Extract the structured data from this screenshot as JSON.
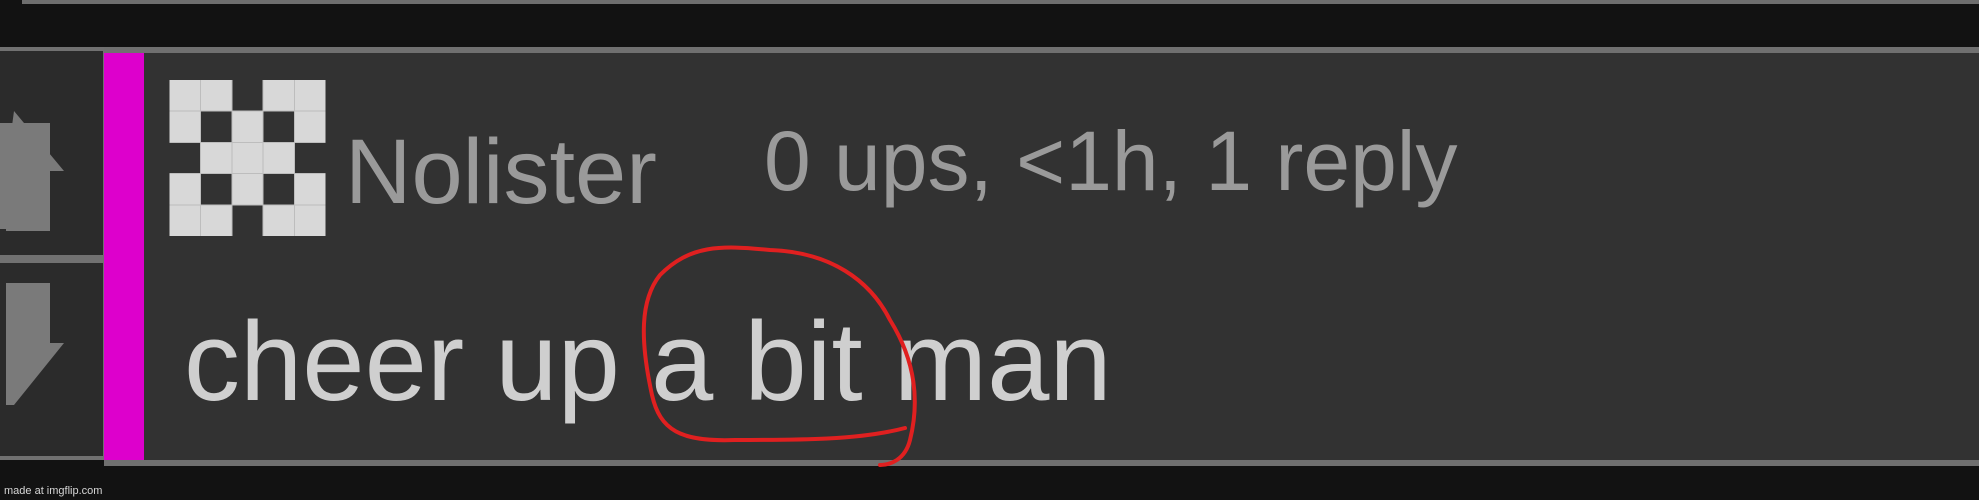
{
  "comment": {
    "username": "Nolister",
    "meta": "0 ups, <1h, 1 reply",
    "body": "cheer up a bit man",
    "depth_color": "#dd00cc"
  },
  "vote": {
    "up_icon": "arrow-up-icon",
    "down_icon": "arrow-down-icon"
  },
  "annotation": {
    "color": "#e02020",
    "circled_text": "a bit"
  },
  "watermark": "made at imgflip.com"
}
